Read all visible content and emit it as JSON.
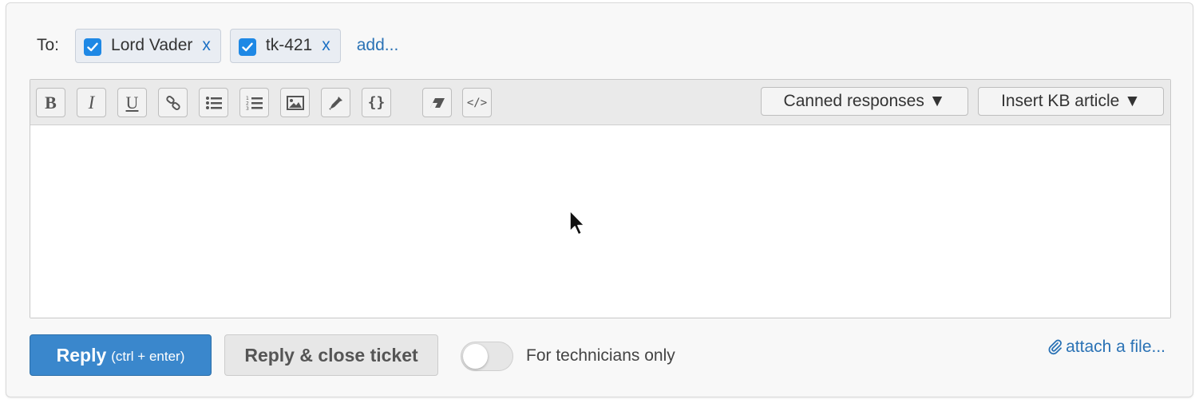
{
  "recipients": {
    "label": "To:",
    "chips": [
      {
        "name": "Lord Vader",
        "checked": true,
        "remove": "x"
      },
      {
        "name": "tk-421",
        "checked": true,
        "remove": "x"
      }
    ],
    "add_label": "add..."
  },
  "toolbar": {
    "buttons": [
      {
        "icon": "bold-icon",
        "glyph": "B"
      },
      {
        "icon": "italic-icon",
        "glyph": "I"
      },
      {
        "icon": "underline-icon",
        "glyph": "U"
      },
      {
        "icon": "link-icon"
      },
      {
        "icon": "bullet-list-icon"
      },
      {
        "icon": "numbered-list-icon"
      },
      {
        "icon": "image-icon"
      },
      {
        "icon": "eyedropper-icon"
      },
      {
        "icon": "code-braces-icon",
        "glyph": "{}"
      },
      {
        "icon": "eraser-icon"
      },
      {
        "icon": "html-source-icon",
        "glyph": "</>"
      }
    ],
    "canned_responses": "Canned responses ▼",
    "insert_kb": "Insert KB article ▼"
  },
  "editor": {
    "content": ""
  },
  "footer": {
    "reply_label": "Reply",
    "reply_hint": "(ctrl + enter)",
    "reply_close_label": "Reply & close ticket",
    "technicians_toggle": {
      "label": "For technicians only",
      "on": false
    },
    "attach_label": "attach a file..."
  },
  "colors": {
    "primary": "#3a87cc",
    "link": "#2a72b5",
    "checkbox": "#1e88e5"
  }
}
